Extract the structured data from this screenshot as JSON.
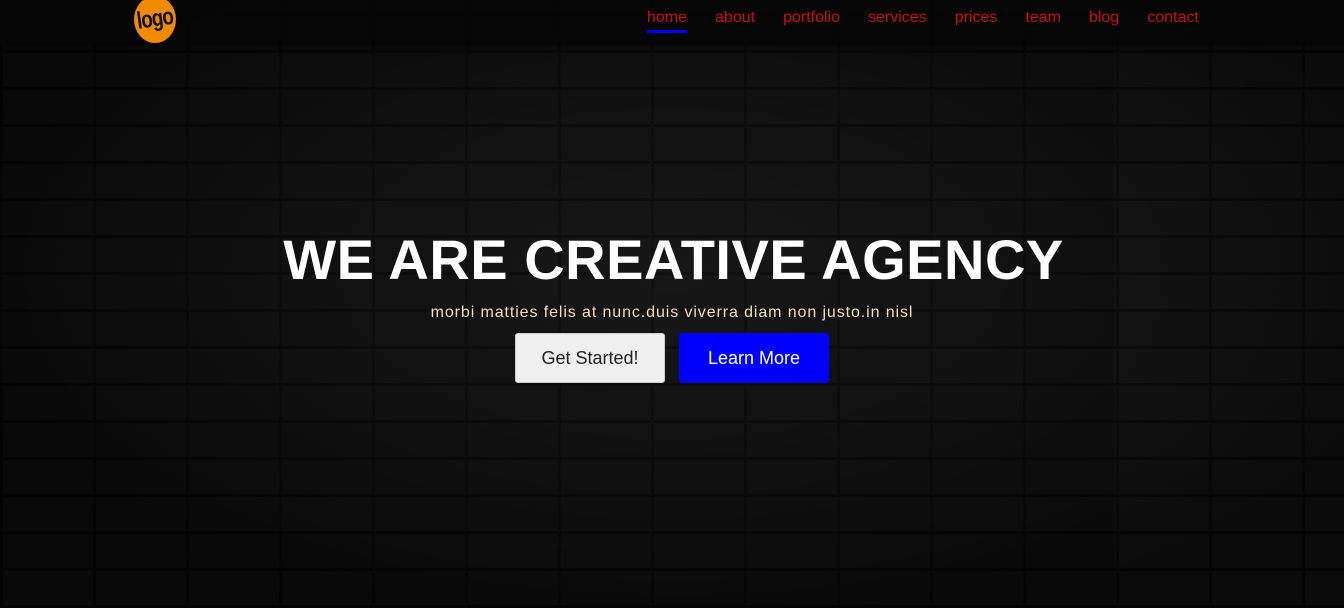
{
  "logo": {
    "text": "logo"
  },
  "nav": {
    "items": [
      {
        "label": "home",
        "active": true
      },
      {
        "label": "about"
      },
      {
        "label": "portfolio"
      },
      {
        "label": "services"
      },
      {
        "label": "prices"
      },
      {
        "label": "team"
      },
      {
        "label": "blog"
      },
      {
        "label": "contact"
      }
    ]
  },
  "hero": {
    "title": "WE ARE CREATIVE AGENCY",
    "subtitle": "morbi matties felis at nunc.duis viverra diam non justo.in nisl",
    "primary_button": "Get Started!",
    "secondary_button": "Learn More"
  },
  "colors": {
    "nav_link": "#c80f14",
    "active_underline": "#0000ff",
    "logo_bg": "#f08a00",
    "primary_button_bg": "#efefef",
    "secondary_button_bg": "#0000ff",
    "subtitle": "#f3dfb8"
  }
}
